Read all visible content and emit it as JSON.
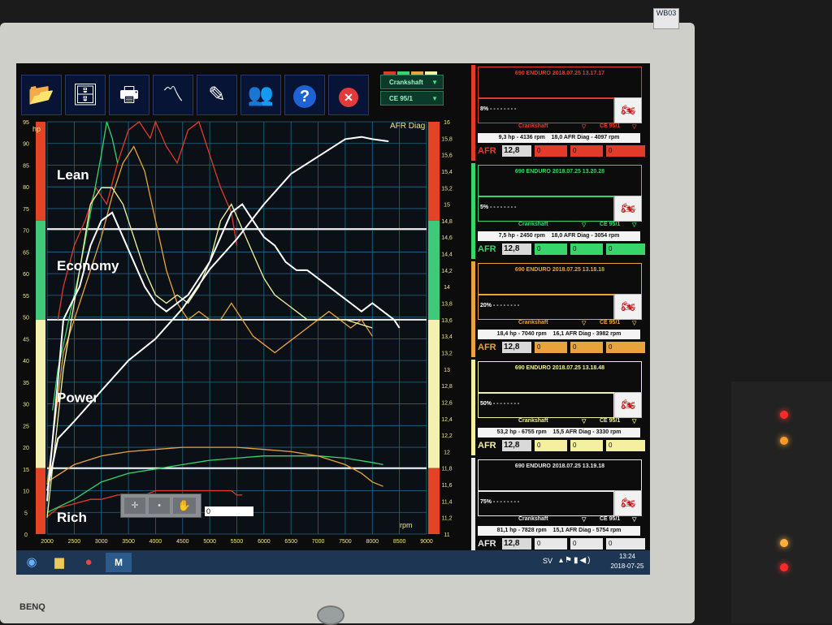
{
  "monitor": {
    "brand": "BENQ",
    "badge": "WB03"
  },
  "toolbar": {
    "buttons": [
      {
        "name": "open-button",
        "icon": "folder-open-icon",
        "glyph": "📂"
      },
      {
        "name": "database-button",
        "icon": "database-icon",
        "glyph": "🗄"
      },
      {
        "name": "print-button",
        "icon": "printer-icon",
        "glyph": "🖶"
      },
      {
        "name": "curve-button",
        "icon": "curve-icon",
        "glyph": "〽"
      },
      {
        "name": "curve-edit-button",
        "icon": "curve-edit-icon",
        "glyph": "✎"
      },
      {
        "name": "users-button",
        "icon": "users-icon",
        "glyph": "👥"
      },
      {
        "name": "help-button",
        "icon": "help-icon",
        "glyph": "?"
      },
      {
        "name": "close-button",
        "icon": "close-icon",
        "glyph": "✕"
      }
    ],
    "dropdown_crank": "Crankshaft",
    "dropdown_ce": "CE 95/1",
    "strip_colors": [
      "#e23b2a",
      "#38d46c",
      "#e8a33c",
      "#f4f4a0"
    ]
  },
  "chart_data": {
    "type": "line",
    "xlabel": "rpm",
    "ylabel": "hp",
    "y2label": "AFR Diag",
    "xlim": [
      2000,
      9000
    ],
    "x_ticks": [
      "2000",
      "2500",
      "3000",
      "3500",
      "4000",
      "4500",
      "5000",
      "5500",
      "6000",
      "6500",
      "7000",
      "7500",
      "8000",
      "8500",
      "9000"
    ],
    "ylim": [
      0,
      95
    ],
    "y_ticks": [
      "0",
      "5",
      "10",
      "15",
      "20",
      "25",
      "30",
      "35",
      "40",
      "45",
      "50",
      "55",
      "60",
      "65",
      "70",
      "75",
      "80",
      "85",
      "90",
      "95"
    ],
    "y2lim": [
      11,
      16
    ],
    "y2_ticks": [
      "11",
      "11,2",
      "11,4",
      "11,6",
      "11,8",
      "12",
      "12,2",
      "12,4",
      "12,6",
      "12,8",
      "13",
      "13,2",
      "13,4",
      "13,6",
      "13,8",
      "14",
      "14,2",
      "14,4",
      "14,6",
      "14,8",
      "15",
      "15,2",
      "15,4",
      "15,6",
      "15,8",
      "16"
    ],
    "zones": [
      {
        "label": "Lean",
        "from": 14.8,
        "to": 16,
        "color": "#e34426"
      },
      {
        "label": "Economy",
        "from": 13.6,
        "to": 14.8,
        "color": "#3fc97a"
      },
      {
        "label": "Power",
        "from": 11.8,
        "to": 13.6,
        "color": "#f4f0b0"
      },
      {
        "label": "Rich",
        "from": 11,
        "to": 11.8,
        "color": "#e34426"
      }
    ],
    "afr_reference_lines": [
      14.7,
      13.6,
      11.8
    ],
    "series": [
      {
        "color": "#e23b2a",
        "axis": "hp",
        "x": [
          2000,
          2200,
          2500,
          2800,
          3000,
          3300,
          3500,
          3800,
          4000,
          4200,
          4500,
          4800,
          5000,
          5200,
          5400,
          5500,
          5600
        ],
        "y": [
          4,
          6,
          7,
          8,
          8,
          9,
          9,
          9,
          10,
          10,
          10,
          10,
          10,
          10,
          10,
          9,
          9
        ]
      },
      {
        "color": "#e23b2a",
        "axis": "afr",
        "x": [
          2200,
          2300,
          2500,
          2700,
          2900,
          3100,
          3300,
          3500,
          3700,
          3900,
          4000,
          4200,
          4400,
          4600,
          4800,
          5000,
          5200,
          5400,
          5500
        ],
        "y": [
          13.6,
          14.0,
          14.5,
          14.8,
          15.2,
          15.0,
          15.5,
          15.9,
          16.0,
          15.8,
          16.0,
          15.7,
          15.5,
          15.9,
          16.0,
          15.6,
          15.2,
          14.9,
          14.5
        ]
      },
      {
        "color": "#38d46c",
        "axis": "hp",
        "x": [
          2000,
          2500,
          3000,
          3500,
          4000,
          4500,
          5000,
          5500,
          6000,
          6500,
          7000,
          7500,
          8000,
          8200
        ],
        "y": [
          5,
          8,
          12,
          14,
          15,
          16,
          17,
          17.5,
          18,
          18,
          18,
          17.5,
          16.5,
          16
        ]
      },
      {
        "color": "#38d46c",
        "axis": "afr",
        "x": [
          2100,
          2200,
          2400,
          2600,
          2800,
          3000,
          3100,
          3200,
          3300
        ],
        "y": [
          12.5,
          13.0,
          13.6,
          14.2,
          14.9,
          15.6,
          16.0,
          15.8,
          15.5
        ]
      },
      {
        "color": "#e8a33c",
        "axis": "hp",
        "x": [
          2000,
          2500,
          3000,
          3500,
          4000,
          4500,
          5000,
          5500,
          6000,
          6500,
          7000,
          7500,
          7800,
          8000,
          8200
        ],
        "y": [
          12,
          16,
          18,
          19,
          19.5,
          20,
          20,
          20,
          19.5,
          19,
          18,
          16,
          14,
          12,
          11
        ]
      },
      {
        "color": "#e8a33c",
        "axis": "afr",
        "x": [
          2000,
          2300,
          2600,
          2800,
          3000,
          3200,
          3400,
          3600,
          3800,
          4000,
          4200,
          4400,
          4600,
          4800,
          5000,
          5200,
          5400,
          5600,
          5800,
          6000,
          6200,
          6400,
          6600,
          6800,
          7000,
          7200,
          7400,
          7600,
          7800,
          8000
        ],
        "y": [
          11.6,
          13.2,
          13.8,
          14.2,
          14.6,
          15.1,
          15.5,
          15.7,
          15.4,
          14.8,
          14.2,
          13.8,
          13.6,
          13.7,
          13.6,
          13.6,
          13.8,
          13.6,
          13.4,
          13.3,
          13.2,
          13.3,
          13.4,
          13.5,
          13.6,
          13.7,
          13.6,
          13.5,
          13.6,
          13.4
        ]
      },
      {
        "color": "#f4f4a0",
        "axis": "afr",
        "x": [
          2000,
          2300,
          2600,
          2800,
          3000,
          3200,
          3400,
          3600,
          3800,
          4000,
          4200,
          4400,
          4600,
          4800,
          5000,
          5200,
          5400,
          5600,
          5800,
          6000,
          6200,
          6400,
          6600,
          6800,
          7000,
          7500,
          8000
        ],
        "y": [
          11.2,
          13.0,
          14.2,
          15.0,
          15.2,
          15.2,
          15.0,
          14.6,
          14.2,
          13.9,
          13.8,
          13.9,
          13.8,
          14.0,
          14.3,
          14.8,
          15.0,
          14.7,
          14.4,
          14.1,
          13.9,
          13.8,
          13.7,
          13.6,
          13.6,
          13.6,
          13.5
        ]
      },
      {
        "color": "#ffffff",
        "axis": "hp",
        "x": [
          2000,
          2200,
          2500,
          3000,
          3500,
          4000,
          4500,
          5000,
          5500,
          6000,
          6500,
          7000,
          7500,
          7800,
          8000,
          8300
        ],
        "y": [
          10,
          22,
          26,
          33,
          40,
          45,
          52,
          61,
          68,
          76,
          83,
          87,
          91,
          91.5,
          91,
          90.5
        ]
      },
      {
        "color": "#ffffff",
        "axis": "afr",
        "x": [
          2000,
          2300,
          2600,
          2800,
          3000,
          3200,
          3400,
          3600,
          3800,
          4000,
          4200,
          4400,
          4600,
          4800,
          5000,
          5200,
          5400,
          5600,
          5800,
          6000,
          6200,
          6400,
          6600,
          6800,
          7000,
          7200,
          7400,
          7600,
          7800,
          8000,
          8200,
          8400,
          8500
        ],
        "y": [
          11.4,
          13.6,
          14.0,
          14.5,
          14.8,
          14.9,
          14.6,
          14.3,
          14.0,
          13.8,
          13.7,
          13.8,
          13.9,
          14.1,
          14.3,
          14.6,
          14.9,
          15.0,
          14.8,
          14.6,
          14.5,
          14.3,
          14.2,
          14.2,
          14.1,
          14.0,
          13.9,
          13.8,
          13.7,
          13.8,
          13.7,
          13.6,
          13.5
        ]
      }
    ]
  },
  "chart_labels": {
    "lean": "Lean",
    "economy": "Economy",
    "power": "Power",
    "rich": "Rich"
  },
  "chart_controls": {
    "value": "0"
  },
  "panels": [
    {
      "color": "#e23b2a",
      "title": "690 ENDURO   2018.07.25 13.17.17",
      "pct": "8%",
      "crank": "Crankshaft",
      "ce": "CE 95/1",
      "stat_left": "9,3 hp - 4136 rpm",
      "stat_right": "18,0 AFR Diag - 4097 rpm",
      "afr_label": "AFR",
      "afr_value": "12,8",
      "cells": [
        "0",
        "0",
        "0"
      ]
    },
    {
      "color": "#38d46c",
      "title": "690 ENDURO   2018.07.25 13.20.28",
      "pct": "5%",
      "crank": "Crankshaft",
      "ce": "CE 95/1",
      "stat_left": "7,5 hp - 2450 rpm",
      "stat_right": "18,0 AFR Diag - 3054 rpm",
      "afr_label": "AFR",
      "afr_value": "12,8",
      "cells": [
        "0",
        "0",
        "0"
      ]
    },
    {
      "color": "#e8a33c",
      "title": "690 ENDURO   2018.07.25 13.18.18",
      "pct": "20%",
      "crank": "Crankshaft",
      "ce": "CE 95/1",
      "stat_left": "18,4 hp - 7040 rpm",
      "stat_right": "16,1 AFR Diag - 3982 rpm",
      "afr_label": "AFR",
      "afr_value": "12,8",
      "cells": [
        "0",
        "0",
        "0"
      ]
    },
    {
      "color": "#f4f0a0",
      "title": "690 ENDURO   2018.07.25 13.18.48",
      "pct": "50%",
      "crank": "Crankshaft",
      "ce": "CE 95/1",
      "stat_left": "53,2 hp - 6755 rpm",
      "stat_right": "15,5 AFR Diag - 3330 rpm",
      "afr_label": "AFR",
      "afr_value": "12,8",
      "cells": [
        "0",
        "0",
        "0"
      ]
    },
    {
      "color": "#e8e8e8",
      "title": "690 ENDURO   2018.07.25 13.19.18",
      "pct": "75%",
      "crank": "Crankshaft",
      "ce": "CE 95/1",
      "stat_left": "81,1 hp - 7828 rpm",
      "stat_right": "15,1 AFR Diag - 5754 rpm",
      "afr_label": "AFR",
      "afr_value": "12,8",
      "cells": [
        "0",
        "0",
        "0"
      ]
    }
  ],
  "taskbar": {
    "lang": "SV",
    "time": "13:24",
    "date": "2018-07-25"
  }
}
